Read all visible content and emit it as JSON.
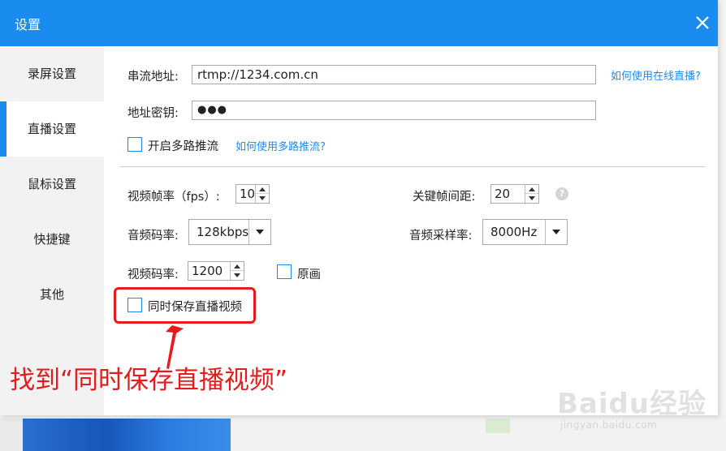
{
  "dialog": {
    "title": "设置"
  },
  "sidebar": {
    "items": [
      {
        "label": "录屏设置",
        "active": false
      },
      {
        "label": "直播设置",
        "active": true
      },
      {
        "label": "鼠标设置",
        "active": false
      },
      {
        "label": "快捷键",
        "active": false
      },
      {
        "label": "其他",
        "active": false
      }
    ]
  },
  "stream": {
    "address_label": "串流地址:",
    "address_value": "rtmp://1234.com.cn",
    "address_help_link": "如何使用在线直播?",
    "key_label": "地址密钥:",
    "key_value": "●●●",
    "multi_checkbox_label": "开启多路推流",
    "multi_checkbox_checked": false,
    "multi_help_link": "如何使用多路推流?"
  },
  "video": {
    "fps_label": "视频帧率（fps）:",
    "fps_value": "10",
    "keyframe_label": "关键帧间距:",
    "keyframe_value": "20",
    "audio_bitrate_label": "音频码率:",
    "audio_bitrate_value": "128kbps",
    "audio_samplerate_label": "音频采样率:",
    "audio_samplerate_value": "8000Hz",
    "video_bitrate_label": "视频码率:",
    "video_bitrate_value": "1200",
    "original_label": "原画",
    "original_checked": false,
    "save_live_label": "同时保存直播视频",
    "save_live_checked": false
  },
  "annotation": {
    "text": "找到“同时保存直播视频”",
    "color": "#e41c1c"
  },
  "watermark": {
    "main": "Baidu经验",
    "sub": "jingyan.baidu.com"
  },
  "colors": {
    "accent": "#1a8cf0",
    "sidebar_bg": "#f2f2f2"
  }
}
